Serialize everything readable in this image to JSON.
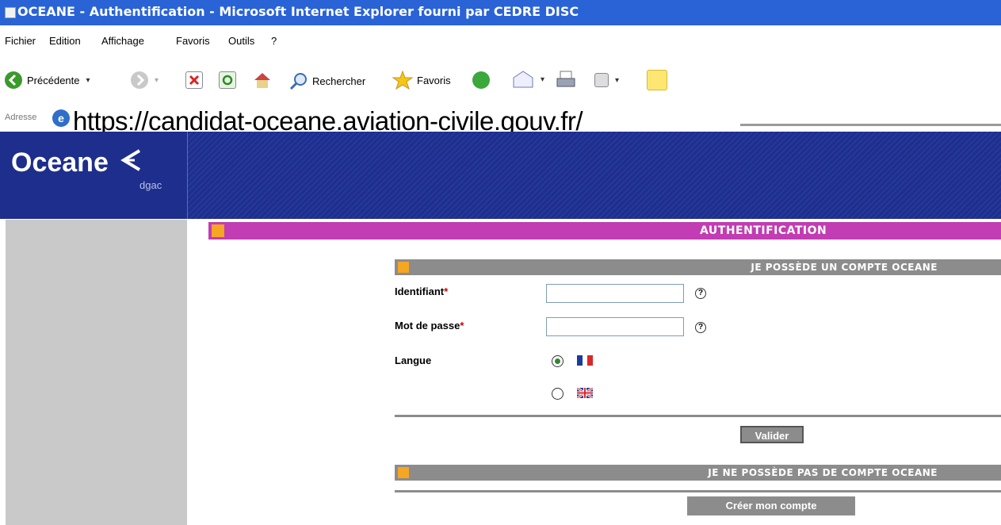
{
  "window": {
    "title": "OCEANE - Authentification - Microsoft Internet Explorer fourni par CEDRE DISC"
  },
  "menu": [
    "Fichier",
    "Edition",
    "Affichage",
    "Favoris",
    "Outils",
    "?"
  ],
  "toolbar": {
    "back_label": "Précédente",
    "search_label": "Rechercher",
    "favorites_label": "Favoris"
  },
  "address": {
    "label": "Adresse",
    "url": "https://candidat-oceane.aviation-civile.gouv.fr/"
  },
  "site": {
    "logo_name": "Oceane",
    "logo_sub": "dgac",
    "page_heading": "AUTHENTIFICATION"
  },
  "login": {
    "section_title": "JE POSSÈDE UN COMPTE OCEANE",
    "identifiant_label": "Identifiant",
    "identifiant_value": "",
    "password_label": "Mot de passe",
    "password_value": "",
    "required_mark": "*",
    "help_symbol": "?",
    "language_label": "Langue",
    "languages": [
      {
        "code": "fr",
        "selected": true
      },
      {
        "code": "en",
        "selected": false
      }
    ],
    "submit_label": "Valider"
  },
  "register": {
    "section_title": "JE NE POSSÈDE PAS DE COMPTE OCEANE",
    "button_label": "Créer mon compte"
  },
  "colors": {
    "titlebar": "#2a63d6",
    "banner": "#1d2e8c",
    "heading_bar": "#c23cb3",
    "section_bar": "#8c8c8c",
    "arrow": "#f5a623"
  }
}
